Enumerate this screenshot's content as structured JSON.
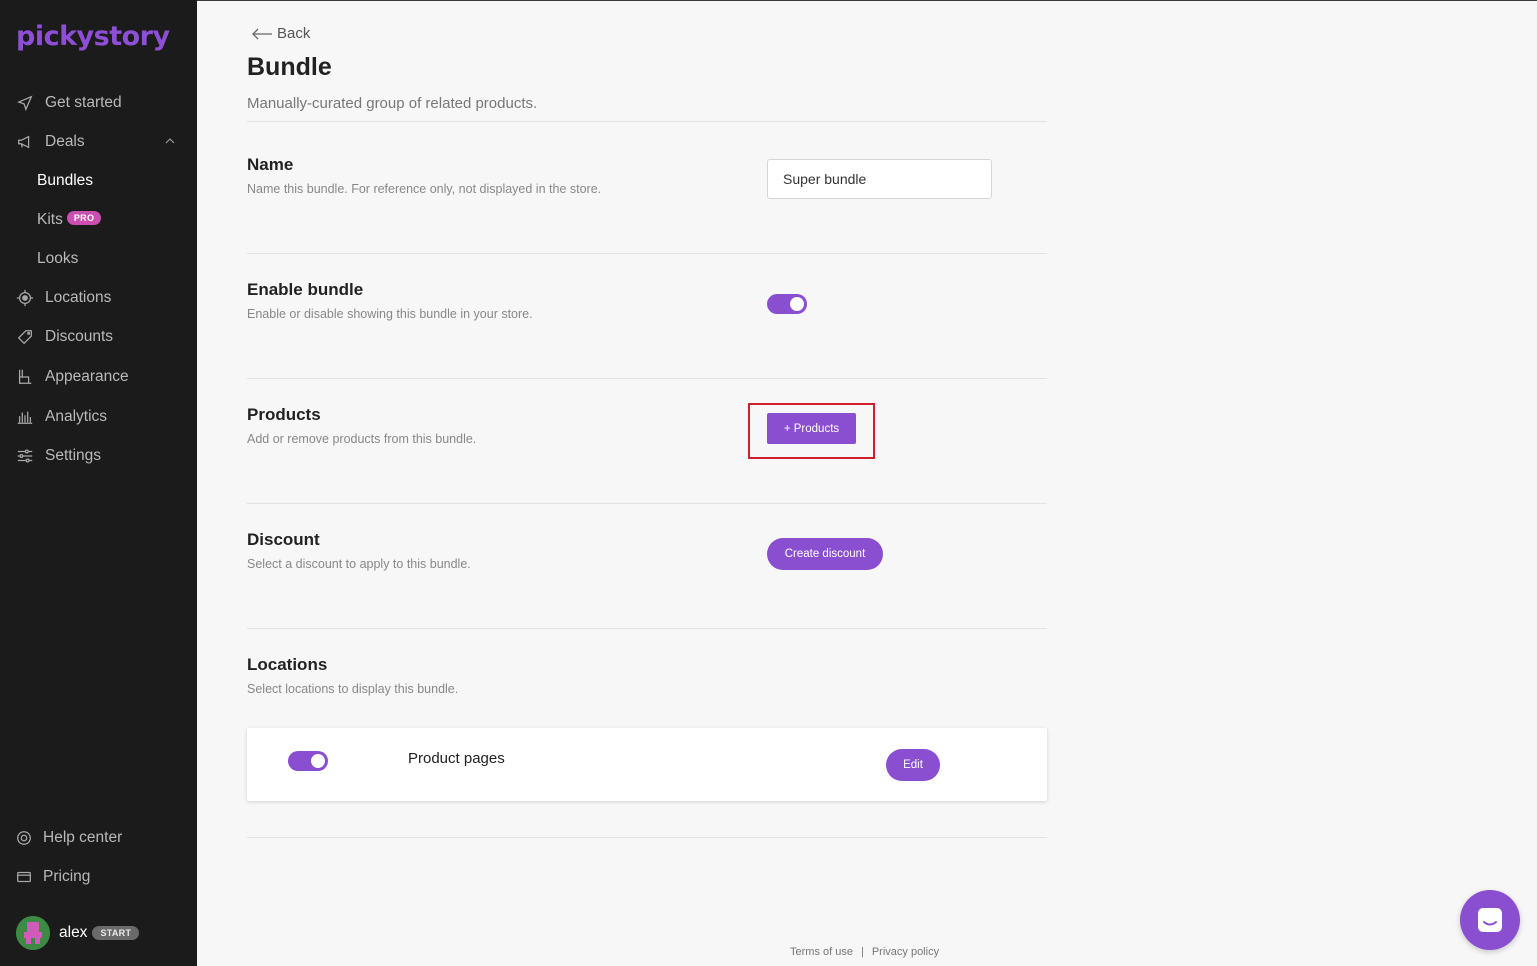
{
  "sidebar": {
    "logo": "pickystory",
    "nav": {
      "get_started": "Get started",
      "deals": "Deals",
      "bundles": "Bundles",
      "kits": "Kits",
      "kits_badge": "PRO",
      "looks": "Looks",
      "locations": "Locations",
      "discounts": "Discounts",
      "appearance": "Appearance",
      "analytics": "Analytics",
      "settings": "Settings"
    },
    "bottom": {
      "help_center": "Help center",
      "pricing": "Pricing"
    },
    "user": {
      "name": "alex",
      "plan_badge": "START"
    }
  },
  "header": {
    "back_label": "Back",
    "title": "Bundle",
    "subtitle": "Manually-curated group of related products."
  },
  "sections": {
    "name": {
      "title": "Name",
      "description": "Name this bundle. For reference only, not displayed in the store.",
      "value": "Super bundle"
    },
    "enable": {
      "title": "Enable bundle",
      "description": "Enable or disable showing this bundle in your store.",
      "enabled": true
    },
    "products": {
      "title": "Products",
      "description": "Add or remove products from this bundle.",
      "button_label": "+ Products"
    },
    "discount": {
      "title": "Discount",
      "description": "Select a discount to apply to this bundle.",
      "button_label": "Create discount"
    },
    "locations": {
      "title": "Locations",
      "description": "Select locations to display this bundle.",
      "items": [
        {
          "label": "Product pages",
          "enabled": true,
          "edit_label": "Edit"
        }
      ]
    }
  },
  "footer": {
    "terms": "Terms of use",
    "separator": "|",
    "privacy": "Privacy policy"
  },
  "colors": {
    "accent": "#8a4fd0",
    "sidebar_bg": "#1b1b1b",
    "highlight": "#cf1f2e",
    "pro_badge": "#c94fb1"
  }
}
